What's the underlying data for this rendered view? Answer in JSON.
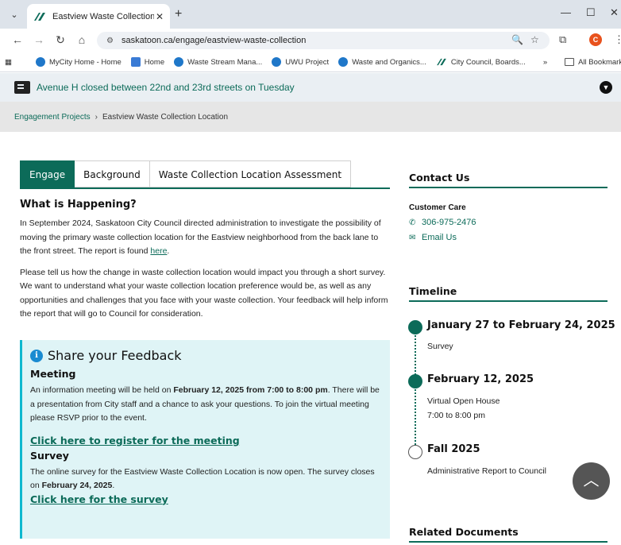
{
  "browser": {
    "tab_title": "Eastview Waste Collection Loca",
    "url": "saskatoon.ca/engage/eastview-waste-collection",
    "bookmarks": [
      {
        "label": "MyCity Home - Home"
      },
      {
        "label": "Home"
      },
      {
        "label": "Waste Stream Mana..."
      },
      {
        "label": "UWU Project"
      },
      {
        "label": "Waste and Organics..."
      },
      {
        "label": "City Council, Boards..."
      }
    ],
    "bookmarks_more": "»",
    "all_bookmarks": "All Bookmarks",
    "profile_initial": "C"
  },
  "alert": {
    "message": "Avenue H closed between 22nd and 23rd streets on Tuesday"
  },
  "breadcrumb": {
    "parent": "Engagement Projects",
    "separator": "›",
    "current": "Eastview Waste Collection Location"
  },
  "tabs": [
    {
      "label": "Engage",
      "active": true
    },
    {
      "label": "Background",
      "active": false
    },
    {
      "label": "Waste Collection Location Assessment",
      "active": false
    }
  ],
  "main": {
    "heading": "What is Happening?",
    "para1_text": "In September 2024, Saskatoon City Council directed administration to investigate the possibility of moving the primary waste collection location for the Eastview neighborhood from the back lane to the front street.  The report is found ",
    "para1_link": "here",
    "para1_end": ".",
    "para2": "Please tell us how the change in waste collection location would impact you through a short survey. We want to understand what your waste collection location preference would be, as well as any opportunities and challenges that you face with your waste collection. Your feedback will help inform the report that will go to Council for consideration."
  },
  "share": {
    "title": "Share your Feedback",
    "meeting_heading": "Meeting",
    "meeting_text_1": "An information meeting will be held on ",
    "meeting_bold": "February 12, 2025 from 7:00 to 8:00 pm",
    "meeting_text_2": ". There will be a presentation from City staff and a chance to ask your questions. To join the virtual meeting please RSVP prior to the event.",
    "meeting_link": "Click here to register for the meeting",
    "survey_heading": "Survey",
    "survey_text_1": "The online survey for the Eastview Waste Collection Location is now open.  The survey closes on ",
    "survey_bold": "February 24, 2025",
    "survey_text_2": ".",
    "survey_link": "Click here for the survey"
  },
  "contact": {
    "heading": "Contact Us",
    "label": "Customer Care",
    "phone": "306-975-2476",
    "email": "Email Us"
  },
  "timeline": {
    "heading": "Timeline",
    "items": [
      {
        "date": "January 27 to February 24, 2025",
        "lines": [
          "Survey"
        ],
        "status": "done"
      },
      {
        "date": "February 12, 2025",
        "lines": [
          "Virtual Open House",
          "7:00 to 8:00 pm"
        ],
        "status": "done"
      },
      {
        "date": "Fall 2025",
        "lines": [
          "Administrative Report to Council"
        ],
        "status": "upcoming"
      }
    ]
  },
  "related": {
    "heading": "Related Documents"
  },
  "colors": {
    "brand_green": "#0c6b59",
    "callout_bg": "#dff4f6",
    "callout_border": "#0fb8cf",
    "alert_bg": "#eaeff3"
  }
}
